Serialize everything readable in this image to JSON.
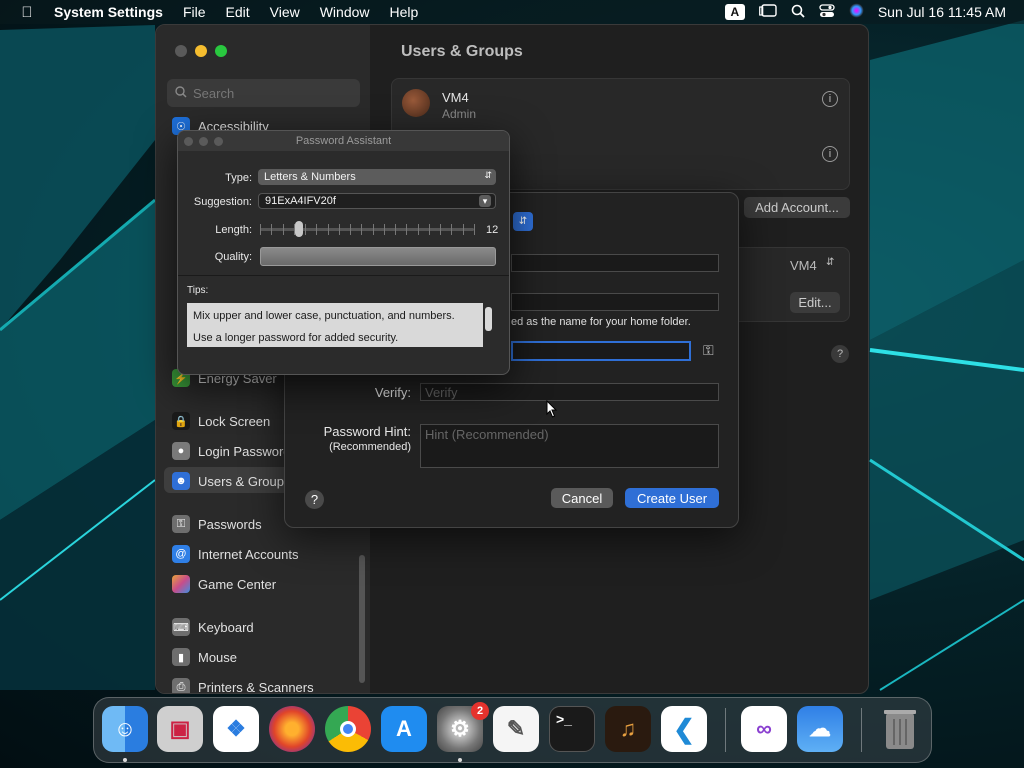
{
  "menubar": {
    "app_name": "System Settings",
    "menus": [
      "File",
      "Edit",
      "View",
      "Window",
      "Help"
    ],
    "input_source": "A",
    "clock": "Sun Jul 16  11:45 AM"
  },
  "settings": {
    "search_placeholder": "Search",
    "page_title": "Users & Groups",
    "sidebar_items": [
      {
        "label": "Accessibility",
        "color": "#1e6fd9"
      },
      {
        "label": "Energy Saver",
        "color": "#3a9a3a"
      },
      {
        "label": "Lock Screen",
        "color": "#2b2b2b"
      },
      {
        "label": "Login Password",
        "color": "#7a7a7a"
      },
      {
        "label": "Users & Groups",
        "color": "#2f6fd6"
      },
      {
        "label": "Passwords",
        "color": "#6e6e6e"
      },
      {
        "label": "Internet Accounts",
        "color": "#2f7fe6"
      },
      {
        "label": "Game Center",
        "color": "#c84d8a"
      },
      {
        "label": "Keyboard",
        "color": "#6e6e6e"
      },
      {
        "label": "Mouse",
        "color": "#6e6e6e"
      },
      {
        "label": "Printers & Scanners",
        "color": "#6e6e6e"
      }
    ],
    "user_name": "VM4",
    "user_role": "Admin",
    "add_account_label": "Add Account...",
    "auto_login_value": "VM4",
    "edit_label": "Edit..."
  },
  "sheet": {
    "home_folder_note": "ed as the name for your home folder.",
    "verify_label": "Verify:",
    "verify_placeholder": "Verify",
    "hint_label": "Password Hint:",
    "hint_sublabel": "(Recommended)",
    "hint_placeholder": "Hint (Recommended)",
    "help_label": "?",
    "cancel_label": "Cancel",
    "create_label": "Create User"
  },
  "password_assistant": {
    "title": "Password Assistant",
    "type_label": "Type:",
    "type_value": "Letters & Numbers",
    "suggestion_label": "Suggestion:",
    "suggestion_value": "91ExA4IFV20f",
    "length_label": "Length:",
    "length_value": "12",
    "length_fraction": 0.18,
    "quality_label": "Quality:",
    "tips_label": "Tips:",
    "tips": [
      "Mix upper and lower case, punctuation, and numbers.",
      "Use a longer password for added security."
    ]
  },
  "dock": {
    "apps": [
      {
        "name": "Finder",
        "color": "#3b8ef0"
      },
      {
        "name": "Launchpad",
        "color": "#d9d9d9"
      },
      {
        "name": "Safari",
        "color": "#2b7de0"
      },
      {
        "name": "Firefox",
        "color": "#6b2fb0"
      },
      {
        "name": "Chrome",
        "color": "#ffffff"
      },
      {
        "name": "App Store",
        "color": "#1f8cf0"
      },
      {
        "name": "System Settings",
        "color": "#8a8a8a"
      },
      {
        "name": "TextEdit",
        "color": "#f2f2f2"
      },
      {
        "name": "Terminal",
        "color": "#1a1a1a"
      },
      {
        "name": "GarageBand",
        "color": "#3a2a1a"
      },
      {
        "name": "Visual Studio Code",
        "color": "#1f8ad6"
      },
      {
        "name": "Visual Studio",
        "color": "#ffffff"
      },
      {
        "name": "Weather",
        "color": "#2f7fe6"
      },
      {
        "name": "Trash",
        "color": "#6a6a6a"
      }
    ],
    "settings_badge": "2"
  }
}
